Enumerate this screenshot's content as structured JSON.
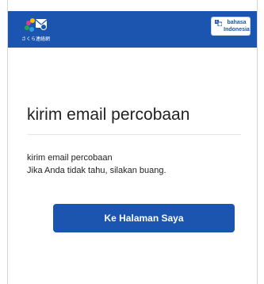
{
  "header": {
    "logo_icon": "envelope-logo-icon",
    "logo_text": "さくら連絡網",
    "language_button": {
      "line1": "bahasa",
      "line2": "Indonesia",
      "icon": "translate-icon"
    }
  },
  "content": {
    "title": "kirim email percobaan",
    "message_line1": "kirim email percobaan",
    "message_line2": "Jika Anda tidak tahu, silakan buang."
  },
  "cta": {
    "label": "Ke Halaman Saya"
  },
  "colors": {
    "brand": "#1b55b0",
    "background": "#ffffff",
    "text": "#222222",
    "divider": "#e6e6e6"
  }
}
